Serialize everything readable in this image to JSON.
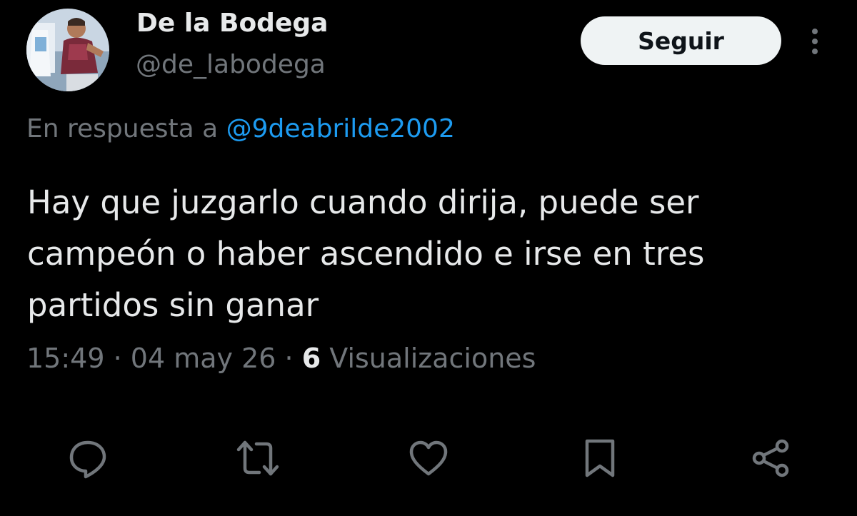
{
  "author": {
    "display_name": "De la Bodega",
    "handle": "@de_labodega",
    "avatar_icon": "avatar-photo"
  },
  "follow_button": {
    "label": "Seguir"
  },
  "more_menu": {
    "icon": "more-vertical-icon"
  },
  "reply_context": {
    "prefix": "En respuesta a",
    "mention": "@9deabrilde2002"
  },
  "tweet": {
    "text": "Hay que juzgarlo cuando dirija, puede ser campeón o haber ascendido e irse en tres partidos sin ganar"
  },
  "meta": {
    "time": "15:49",
    "separator": "·",
    "date": "04 may 26",
    "views_count": "6",
    "views_label": "Visualizaciones"
  },
  "actions": [
    {
      "icon": "reply-icon"
    },
    {
      "icon": "retweet-icon"
    },
    {
      "icon": "like-icon"
    },
    {
      "icon": "bookmark-icon"
    },
    {
      "icon": "share-icon"
    }
  ],
  "colors": {
    "background": "#000000",
    "primary_text": "#e7e9ea",
    "secondary_text": "#71767b",
    "link": "#1d9bf0",
    "button_bg": "#eff3f4"
  }
}
